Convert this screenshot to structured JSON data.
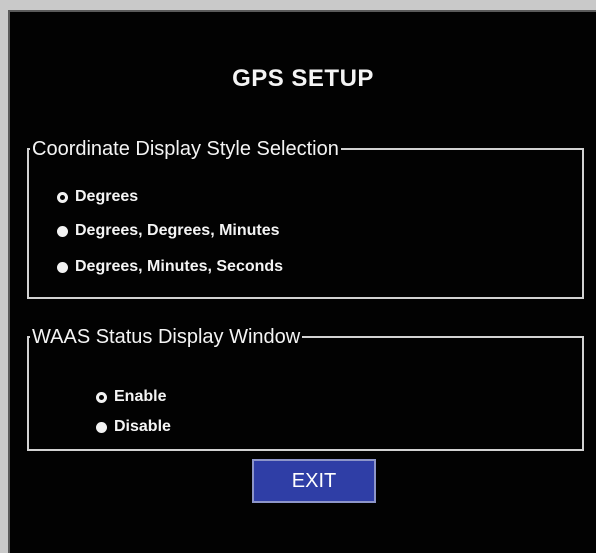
{
  "title": "GPS SETUP",
  "coordinate_group": {
    "legend": "Coordinate Display Style Selection",
    "options": [
      {
        "label": "Degrees",
        "selected": true
      },
      {
        "label": "Degrees, Degrees, Minutes",
        "selected": false
      },
      {
        "label": "Degrees, Minutes, Seconds",
        "selected": false
      }
    ]
  },
  "waas_group": {
    "legend": "WAAS Status Display Window",
    "options": [
      {
        "label": "Enable",
        "selected": true
      },
      {
        "label": "Disable",
        "selected": false
      }
    ]
  },
  "exit_label": "EXIT",
  "colors": {
    "background": "#020202",
    "text": "#f4f4f4",
    "border": "#d2d2d2",
    "exit_button": "#2f3ea6"
  }
}
